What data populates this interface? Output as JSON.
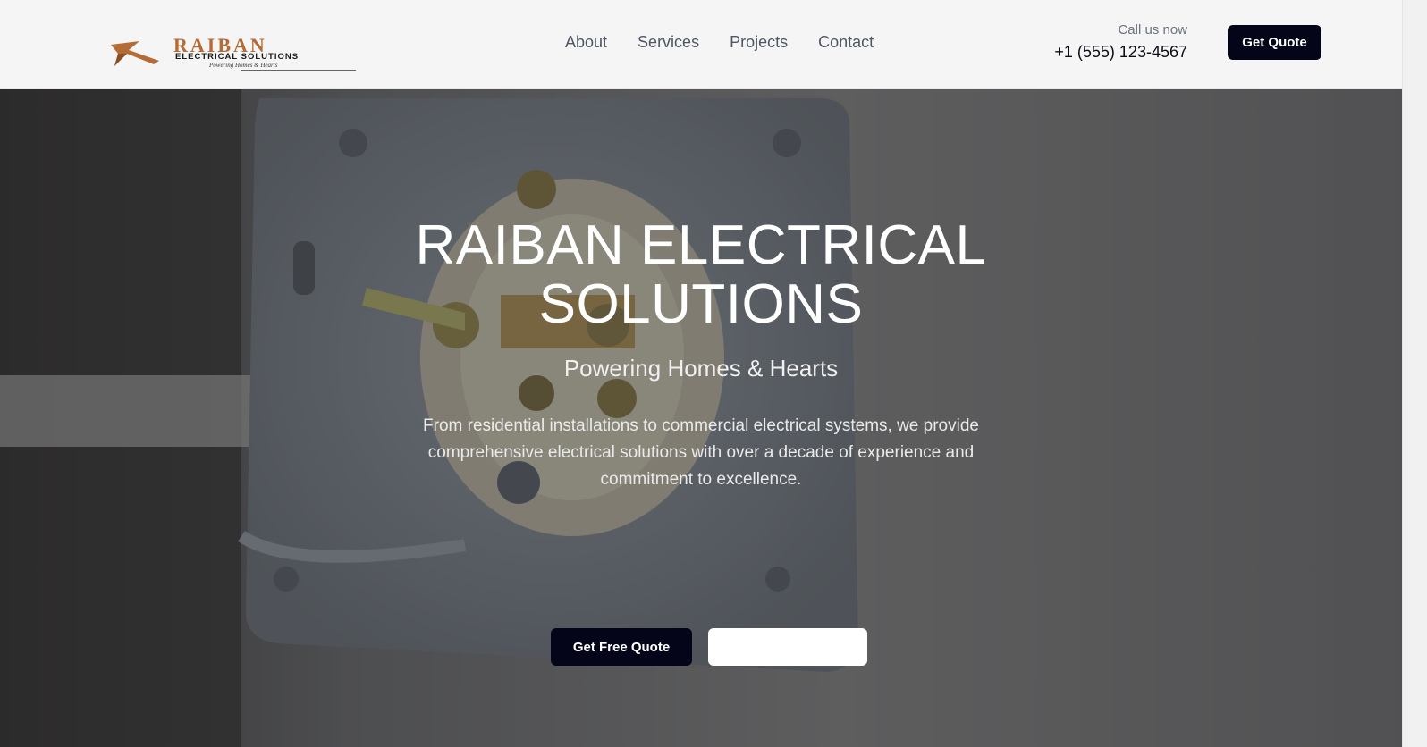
{
  "header": {
    "logo": {
      "name": "RAIBAN",
      "subtitle": "ELECTRICAL SOLUTIONS",
      "tagline": "Powering Homes & Hearts"
    },
    "nav": [
      {
        "label": "About"
      },
      {
        "label": "Services"
      },
      {
        "label": "Projects"
      },
      {
        "label": "Contact"
      }
    ],
    "call_label": "Call us now",
    "phone": "+1 (555) 123-4567",
    "quote_button": "Get Quote"
  },
  "hero": {
    "title": "RAIBAN ELECTRICAL SOLUTIONS",
    "subtitle": "Powering Homes & Hearts",
    "description": "From residential installations to commercial electrical systems, we provide comprehensive electrical solutions with over a decade of experience and commitment to excellence.",
    "primary_button": "Get Free Quote",
    "secondary_button": ""
  },
  "colors": {
    "brand": "#b56b35",
    "primary_button": "#05051a",
    "header_bg": "#f5f5f5"
  }
}
